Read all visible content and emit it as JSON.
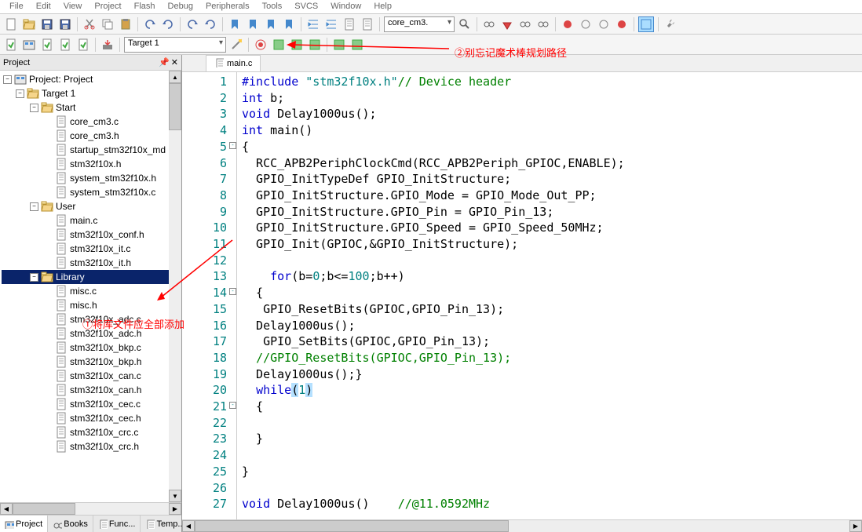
{
  "menu": [
    "File",
    "Edit",
    "View",
    "Project",
    "Flash",
    "Debug",
    "Peripherals",
    "Tools",
    "SVCS",
    "Window",
    "Help"
  ],
  "toolbar2": {
    "target_label": "Target 1",
    "dropdown2": "core_cm3."
  },
  "panel": {
    "title": "Project",
    "tabs": [
      "Project",
      "Books",
      "Func...",
      "Temp..."
    ]
  },
  "tree": {
    "root": "Project: Project",
    "target": "Target 1",
    "groups": [
      {
        "name": "Start",
        "files": [
          "core_cm3.c",
          "core_cm3.h",
          "startup_stm32f10x_md",
          "stm32f10x.h",
          "system_stm32f10x.h",
          "system_stm32f10x.c"
        ]
      },
      {
        "name": "User",
        "files": [
          "main.c",
          "stm32f10x_conf.h",
          "stm32f10x_it.c",
          "stm32f10x_it.h"
        ]
      },
      {
        "name": "Library",
        "files": [
          "misc.c",
          "misc.h",
          "stm32f10x_adc.c",
          "stm32f10x_adc.h",
          "stm32f10x_bkp.c",
          "stm32f10x_bkp.h",
          "stm32f10x_can.c",
          "stm32f10x_can.h",
          "stm32f10x_cec.c",
          "stm32f10x_cec.h",
          "stm32f10x_crc.c",
          "stm32f10x_crc.h"
        ]
      }
    ]
  },
  "editor": {
    "tab": "main.c",
    "lines": [
      {
        "n": 1,
        "tokens": [
          [
            "kw",
            "#include "
          ],
          [
            "str",
            "\"stm32f10x.h\""
          ],
          [
            "cmt",
            "// Device header"
          ]
        ]
      },
      {
        "n": 2,
        "tokens": [
          [
            "kw",
            "int"
          ],
          [
            "",
            " b;"
          ]
        ]
      },
      {
        "n": 3,
        "tokens": [
          [
            "kw",
            "void"
          ],
          [
            "",
            " Delay1000us();"
          ]
        ]
      },
      {
        "n": 4,
        "tokens": [
          [
            "kw",
            "int"
          ],
          [
            "",
            " main()"
          ]
        ]
      },
      {
        "n": 5,
        "tokens": [
          [
            "",
            "{"
          ]
        ],
        "fold": "-"
      },
      {
        "n": 6,
        "tokens": [
          [
            "",
            "  RCC_APB2PeriphClockCmd(RCC_APB2Periph_GPIOC,ENABLE);"
          ]
        ]
      },
      {
        "n": 7,
        "tokens": [
          [
            "",
            "  GPIO_InitTypeDef GPIO_InitStructure;"
          ]
        ]
      },
      {
        "n": 8,
        "tokens": [
          [
            "",
            "  GPIO_InitStructure.GPIO_Mode = GPIO_Mode_Out_PP;"
          ]
        ]
      },
      {
        "n": 9,
        "tokens": [
          [
            "",
            "  GPIO_InitStructure.GPIO_Pin = GPIO_Pin_13;"
          ]
        ]
      },
      {
        "n": 10,
        "tokens": [
          [
            "",
            "  GPIO_InitStructure.GPIO_Speed = GPIO_Speed_50MHz;"
          ]
        ]
      },
      {
        "n": 11,
        "tokens": [
          [
            "",
            "  GPIO_Init(GPIOC,&GPIO_InitStructure);"
          ]
        ]
      },
      {
        "n": 12,
        "tokens": [
          [
            "",
            ""
          ]
        ]
      },
      {
        "n": 13,
        "tokens": [
          [
            "",
            "    "
          ],
          [
            "kw",
            "for"
          ],
          [
            "",
            "(b="
          ],
          [
            "num",
            "0"
          ],
          [
            "",
            ";b<="
          ],
          [
            "num",
            "100"
          ],
          [
            "",
            ";b++)"
          ]
        ]
      },
      {
        "n": 14,
        "tokens": [
          [
            "",
            "  {"
          ]
        ],
        "fold": "-"
      },
      {
        "n": 15,
        "tokens": [
          [
            "",
            "   GPIO_ResetBits(GPIOC,GPIO_Pin_13); "
          ]
        ]
      },
      {
        "n": 16,
        "tokens": [
          [
            "",
            "  Delay1000us();"
          ]
        ]
      },
      {
        "n": 17,
        "tokens": [
          [
            "",
            "   GPIO_SetBits(GPIOC,GPIO_Pin_13);"
          ]
        ]
      },
      {
        "n": 18,
        "tokens": [
          [
            "",
            "  "
          ],
          [
            "cmt",
            "//GPIO_ResetBits(GPIOC,GPIO_Pin_13);"
          ]
        ]
      },
      {
        "n": 19,
        "tokens": [
          [
            "",
            "  Delay1000us();}"
          ]
        ]
      },
      {
        "n": 20,
        "tokens": [
          [
            "",
            "  "
          ],
          [
            "kw",
            "while"
          ],
          [
            "hl",
            "("
          ],
          [
            "num",
            "1"
          ],
          [
            "hl",
            ")"
          ]
        ]
      },
      {
        "n": 21,
        "tokens": [
          [
            "",
            "  {"
          ]
        ],
        "fold": "-"
      },
      {
        "n": 22,
        "tokens": [
          [
            "",
            ""
          ]
        ]
      },
      {
        "n": 23,
        "tokens": [
          [
            "",
            "  }"
          ]
        ]
      },
      {
        "n": 24,
        "tokens": [
          [
            "",
            ""
          ]
        ]
      },
      {
        "n": 25,
        "tokens": [
          [
            "",
            "}"
          ]
        ]
      },
      {
        "n": 26,
        "tokens": [
          [
            "",
            ""
          ]
        ]
      },
      {
        "n": 27,
        "tokens": [
          [
            "kw",
            "void"
          ],
          [
            "",
            " Delay1000us()    "
          ],
          [
            "cmt",
            "//@11.0592MHz"
          ]
        ]
      }
    ]
  },
  "annotations": {
    "a1": "①将库文件应全部添加",
    "a2": "②别忘记魔术棒规划路径"
  }
}
